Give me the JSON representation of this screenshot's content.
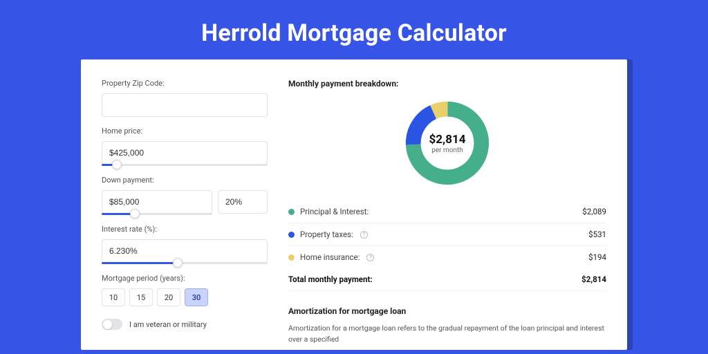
{
  "title": "Herrold Mortgage Calculator",
  "form": {
    "zip_label": "Property Zip Code:",
    "zip_value": "",
    "home_price_label": "Home price:",
    "home_price_value": "$425,000",
    "home_price_slider_pct": 9,
    "down_payment_label": "Down payment:",
    "down_payment_value": "$85,000",
    "down_payment_pct_value": "20%",
    "down_payment_slider_pct": 30,
    "interest_label": "Interest rate (%):",
    "interest_value": "6.230%",
    "interest_slider_pct": 46,
    "period_label": "Mortgage period (years):",
    "periods": [
      "10",
      "15",
      "20",
      "30"
    ],
    "period_active_index": 3,
    "veteran_label": "I am veteran or military",
    "veteran_on": false
  },
  "breakdown": {
    "title": "Monthly payment breakdown:",
    "donut_amount": "$2,814",
    "donut_sub": "per month",
    "items": [
      {
        "label": "Principal & Interest:",
        "value": "$2,089",
        "color": "#45ae8b",
        "info": false
      },
      {
        "label": "Property taxes:",
        "value": "$531",
        "color": "#2a54e3",
        "info": true
      },
      {
        "label": "Home insurance:",
        "value": "$194",
        "color": "#ead06a",
        "info": true
      }
    ],
    "total_label": "Total monthly payment:",
    "total_value": "$2,814"
  },
  "amortization": {
    "title": "Amortization for mortgage loan",
    "body": "Amortization for a mortgage loan refers to the gradual repayment of the loan principal and interest over a specified"
  },
  "chart_data": {
    "type": "pie",
    "title": "Monthly payment breakdown",
    "series": [
      {
        "name": "Principal & Interest",
        "value": 2089,
        "color": "#45ae8b"
      },
      {
        "name": "Property taxes",
        "value": 531,
        "color": "#2a54e3"
      },
      {
        "name": "Home insurance",
        "value": 194,
        "color": "#ead06a"
      }
    ],
    "total": 2814,
    "center_label": "$2,814 per month"
  }
}
